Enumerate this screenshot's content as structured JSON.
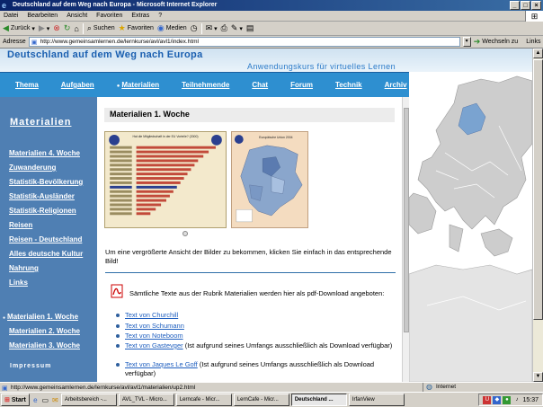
{
  "window": {
    "title": "Deutschland auf dem Weg nach Europa - Microsoft Internet Explorer",
    "controls": [
      "_",
      "□",
      "×"
    ]
  },
  "menubar": [
    "Datei",
    "Bearbeiten",
    "Ansicht",
    "Favoriten",
    "Extras",
    "?"
  ],
  "toolbar": {
    "back": "Zurück",
    "search": "Suchen",
    "favorites": "Favoriten",
    "media": "Medien"
  },
  "addressbar": {
    "label": "Adresse",
    "url": "http://www.gemeinsamlernen.de/lernkurse/avl/avl1/index.html",
    "go_label": "Wechseln zu",
    "links_label": "Links"
  },
  "site": {
    "title": "Deutschland auf dem Weg nach Europa",
    "subtitle": "Anwendungskurs für virtuelles Lernen",
    "nav": [
      "Thema",
      "Aufgaben",
      "Materialien",
      "Teilnehmende",
      "Chat",
      "Forum",
      "Technik",
      "Archiv"
    ],
    "nav_active": "Materialien",
    "sidebar": {
      "heading": "Materialien",
      "links_top": [
        "Materialien 4. Woche",
        "Zuwanderung",
        "Statistik-Bevölkerung",
        "Statistik-Ausländer",
        "Statistik-Religionen",
        "Reisen",
        "Reisen - Deutschland",
        "Alles deutsche Kultur",
        "Nahrung",
        "Links"
      ],
      "links_weeks": [
        "Materialien 1. Woche",
        "Materialien 2. Woche",
        "Materialien 3. Woche"
      ],
      "impressum": "Impressum"
    },
    "content": {
      "title": "Materialien 1. Woche",
      "image_chart_title": "Hat die Mitgliedschaft in der EU Vorteile? (2000)",
      "image_map_title": "Europäische Union 2004",
      "info_text": "Um eine vergrößerte Ansicht der Bilder zu bekommen, klicken Sie einfach in das entsprechende Bild!",
      "pdf_text": "Sämtliche Texte aus der Rubrik Materialien werden hier als pdf-Download angeboten:",
      "downloads": [
        {
          "link": "Text von Churchill",
          "note": ""
        },
        {
          "link": "Text von Schumann",
          "note": ""
        },
        {
          "link": "Text von Noteboom",
          "note": ""
        },
        {
          "link": "Text von Gastevger",
          "note": " (Ist aufgrund seines Umfangs ausschließlich als Download verfügbar)"
        },
        {
          "link": "Text von Jaques Le Goff",
          "note": " (Ist aufgrund seines Umfangs ausschließlich als Download verfügbar)"
        }
      ]
    }
  },
  "statusbar": {
    "url": "http://www.gemeinsamlernen.de/lernkurse/avl/avl1/materialien/up2.html",
    "zone": "Internet"
  },
  "taskbar": {
    "start": "Start",
    "tasks": [
      "Arbeitsbereich -...",
      "AVL_TVL - Micro...",
      "Lerncafe - Micr...",
      "LernCafe - Micr...",
      "Deutschland ...",
      "IrfanView"
    ],
    "active_task": "Deutschland ...",
    "clock": "15:37"
  },
  "colors": {
    "nav_bg": "#2e8fd0",
    "sidebar_bg": "#4f7fb3",
    "link": "#1f5fbf",
    "titlebar": "#0a246a"
  }
}
